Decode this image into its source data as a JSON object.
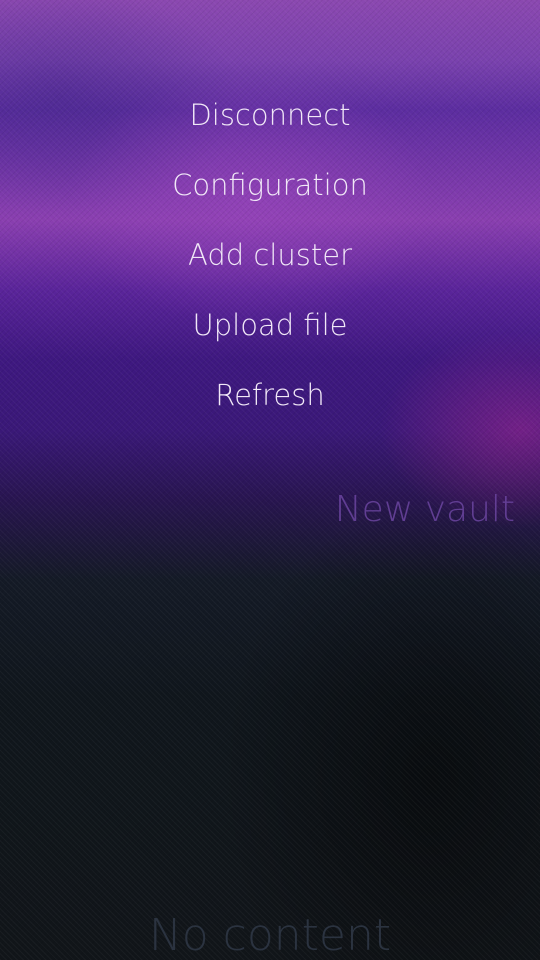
{
  "pulley_menu": {
    "items": [
      {
        "label": "Disconnect"
      },
      {
        "label": "Configuration"
      },
      {
        "label": "Add cluster"
      },
      {
        "label": "Upload file"
      },
      {
        "label": "Refresh"
      }
    ]
  },
  "page_header": {
    "title": "New vault"
  },
  "placeholder": {
    "text": "No content"
  },
  "colors": {
    "menu_text": "#f1e8f7",
    "header_text": "#6b45a0",
    "placeholder_text": "#2b3340"
  }
}
